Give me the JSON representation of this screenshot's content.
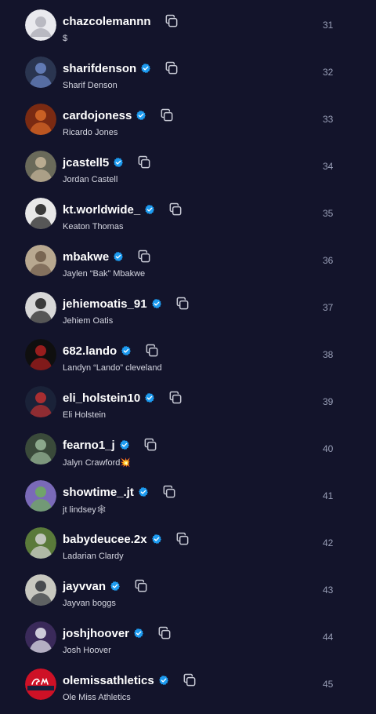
{
  "colors": {
    "background": "#13142b",
    "verified": "#1d9bf0",
    "rank_text": "#9aa0b8"
  },
  "rows": [
    {
      "username": "chazcolemannn",
      "name": "$",
      "rank": "31",
      "verified": false,
      "avatar": "default-avatar",
      "avatar_colors": [
        "#e9e9ee",
        "#b9b9c2"
      ]
    },
    {
      "username": "sharifdenson",
      "name": "Sharif Denson",
      "rank": "32",
      "verified": true,
      "avatar": "user-photo",
      "avatar_colors": [
        "#2a3550",
        "#6b86c4"
      ]
    },
    {
      "username": "cardojoness",
      "name": "Ricardo Jones",
      "rank": "33",
      "verified": true,
      "avatar": "user-photo",
      "avatar_colors": [
        "#7a2a12",
        "#d86a28"
      ]
    },
    {
      "username": "jcastell5",
      "name": "Jordan Castell",
      "rank": "34",
      "verified": true,
      "avatar": "user-photo",
      "avatar_colors": [
        "#6a6a5a",
        "#c7b69a"
      ]
    },
    {
      "username": "kt.worldwide_",
      "name": "Keaton Thomas",
      "rank": "35",
      "verified": true,
      "avatar": "user-photo",
      "avatar_colors": [
        "#e8e8e8",
        "#1a1a1a"
      ]
    },
    {
      "username": "mbakwe",
      "name": "Jaylen “Bak” Mbakwe",
      "rank": "36",
      "verified": true,
      "avatar": "user-photo",
      "avatar_colors": [
        "#b8a890",
        "#6d5a48"
      ]
    },
    {
      "username": "jehiemoatis_91",
      "name": "Jehiem Oatis",
      "rank": "37",
      "verified": true,
      "avatar": "user-photo",
      "avatar_colors": [
        "#d8d8d8",
        "#202020"
      ]
    },
    {
      "username": "682.lando",
      "name": "Landyn “Lando” cleveland",
      "rank": "38",
      "verified": true,
      "avatar": "user-photo",
      "avatar_colors": [
        "#0f0f0f",
        "#b02020"
      ]
    },
    {
      "username": "eli_holstein10",
      "name": "Eli Holstein",
      "rank": "39",
      "verified": true,
      "avatar": "user-photo",
      "avatar_colors": [
        "#1a2238",
        "#c23030"
      ]
    },
    {
      "username": "fearno1_j",
      "name": "Jalyn Crawford💥",
      "rank": "40",
      "verified": true,
      "avatar": "user-photo",
      "avatar_colors": [
        "#3a4a3a",
        "#9ab89a"
      ]
    },
    {
      "username": "showtime_.jt",
      "name": "jt lindsey🕸",
      "rank": "41",
      "verified": true,
      "avatar": "user-photo",
      "avatar_colors": [
        "#7a6ab8",
        "#6fae5a"
      ]
    },
    {
      "username": "babydeucee.2x",
      "name": "Ladarian Clardy",
      "rank": "42",
      "verified": true,
      "avatar": "user-photo",
      "avatar_colors": [
        "#5a7a3a",
        "#d4d4d4"
      ]
    },
    {
      "username": "jayvvan",
      "name": "Jayvan boggs",
      "rank": "43",
      "verified": true,
      "avatar": "user-photo",
      "avatar_colors": [
        "#c8c8c0",
        "#30343a"
      ]
    },
    {
      "username": "joshjhoover",
      "name": "Josh Hoover",
      "rank": "44",
      "verified": true,
      "avatar": "user-photo",
      "avatar_colors": [
        "#3a2a5a",
        "#e8e8f0"
      ]
    },
    {
      "username": "olemissathletics",
      "name": "Ole Miss Athletics",
      "rank": "45",
      "verified": true,
      "avatar": "ole-miss-logo",
      "avatar_colors": [
        "#ce1126",
        "#14213d"
      ]
    }
  ]
}
